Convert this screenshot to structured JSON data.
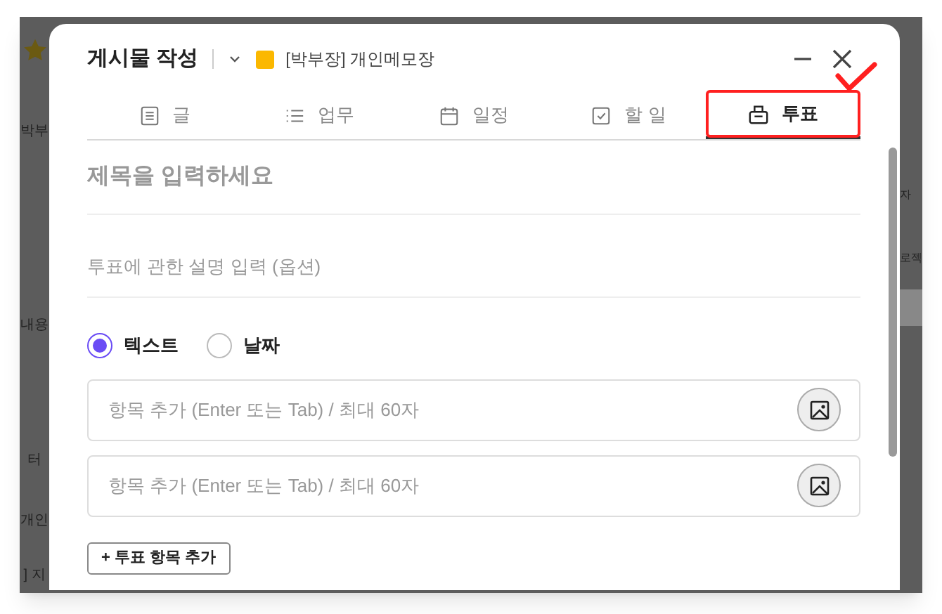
{
  "background": {
    "left_texts": [
      "박부",
      "내용",
      "터",
      "개인",
      "] 지"
    ],
    "right_texts": [
      "자",
      "로젝"
    ]
  },
  "dialog": {
    "title": "게시물 작성",
    "board": {
      "name": "[박부장] 개인메모장",
      "color": "#fbb800"
    },
    "tabs": [
      {
        "label": "글",
        "selected": false,
        "annotated": false
      },
      {
        "label": "업무",
        "selected": false,
        "annotated": false
      },
      {
        "label": "일정",
        "selected": false,
        "annotated": false
      },
      {
        "label": "할 일",
        "selected": false,
        "annotated": false
      },
      {
        "label": "투표",
        "selected": true,
        "annotated": true
      }
    ],
    "title_placeholder": "제목을 입력하세요",
    "description_placeholder": "투표에 관한 설명 입력 (옵션)",
    "vote_types": [
      {
        "label": "텍스트",
        "selected": true
      },
      {
        "label": "날짜",
        "selected": false
      }
    ],
    "options": [
      {
        "placeholder": "항목 추가 (Enter 또는 Tab) / 최대 60자"
      },
      {
        "placeholder": "항목 추가 (Enter 또는 Tab) / 최대 60자"
      }
    ],
    "add_option_button": "+ 투표 항목 추가"
  }
}
